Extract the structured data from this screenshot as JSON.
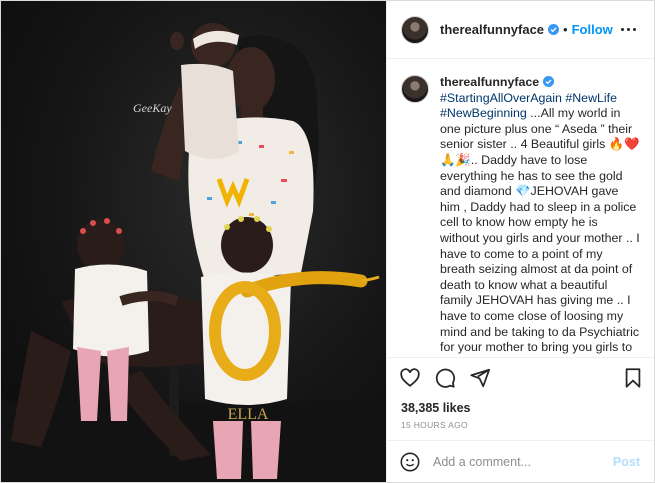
{
  "post": {
    "username": "therealfunnyface",
    "follow_label": "Follow",
    "separator": "•",
    "caption": {
      "username": "therealfunnyface",
      "hashtags": "#StartingAllOverAgain #NewLife #NewBeginning",
      "text_part1": " ...All my world in one picture plus one “ Aseda ” their senior sister .. 4 Beautiful girls 🔥❤️🙏🎉.. Daddy have to lose everything he has to see the gold and diamond 💎JEHOVAH gave him , Daddy had to sleep in a police cell to know how empty he is without you girls and your mother .. I have to come to a point of my breath seizing almost at da point of death to know what a beautiful family JEHOVAH has giving me .. I have to come close of loosing my mind and be taking to da Psychiatric for your mother to bring you girls to see me to gain my sanity .. especially KIMBERLYN.."
    },
    "photo": {
      "watermark": "GeeKay",
      "shirt_text": "ELLA"
    },
    "likes": "38,385 likes",
    "time_ago": "15 HOURS AGO",
    "comment_placeholder": "Add a comment...",
    "post_label": "Post",
    "icons": {
      "verified": "verified-badge-icon",
      "more": "more-options-icon",
      "like": "heart-icon",
      "comment": "comment-icon",
      "share": "share-icon",
      "save": "bookmark-icon",
      "emoji": "emoji-icon"
    },
    "colors": {
      "link_blue": "#0095f6",
      "hashtag_blue": "#00376b",
      "post_disabled": "#b2dffc",
      "meta_gray": "#8e8e8e"
    }
  }
}
